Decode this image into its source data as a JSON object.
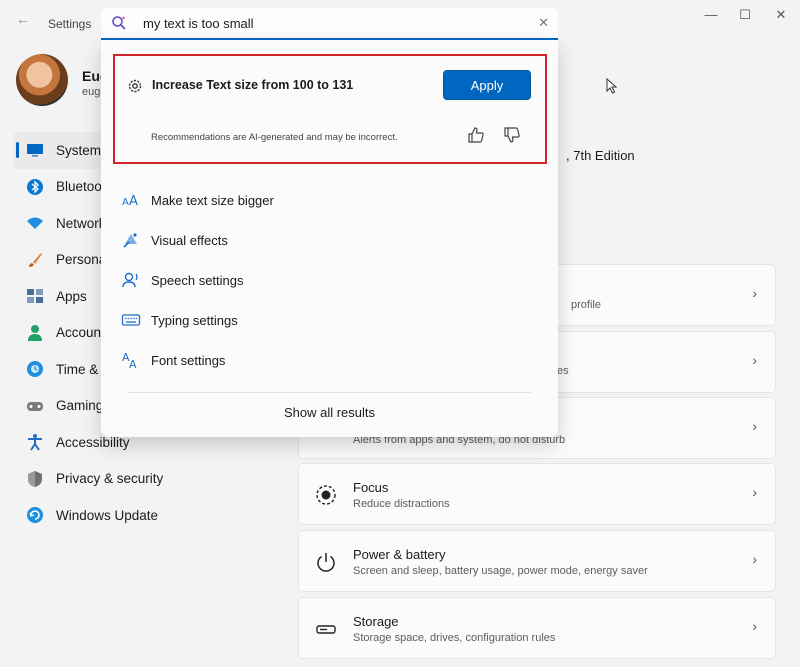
{
  "window": {
    "app_title": "Settings",
    "back_icon": "back-arrow-icon",
    "min_icon": "minimize-icon",
    "max_icon": "maximize-icon",
    "close_icon": "close-icon"
  },
  "profile": {
    "name": "Eug",
    "email": "eug"
  },
  "sidebar": {
    "items": [
      {
        "label": "System",
        "icon": "monitor-icon",
        "color": "#0067c0",
        "active": true
      },
      {
        "label": "Bluetoo",
        "icon": "bluetooth-icon",
        "color": "#0a78d4"
      },
      {
        "label": "Network",
        "icon": "wifi-icon",
        "color": "#1f8fe0"
      },
      {
        "label": "Persona",
        "icon": "brush-icon",
        "color": "#e08a3c"
      },
      {
        "label": "Apps",
        "icon": "apps-icon",
        "color": "#4a6e9a"
      },
      {
        "label": "Account",
        "icon": "person-icon",
        "color": "#1fa16a"
      },
      {
        "label": "Time &",
        "icon": "clock-globe-icon",
        "color": "#1f8fe0"
      },
      {
        "label": "Gaming",
        "icon": "gamepad-icon",
        "color": "#7b7b7b"
      },
      {
        "label": "Accessibility",
        "icon": "accessibility-icon",
        "color": "#1f6fc4"
      },
      {
        "label": "Privacy & security",
        "icon": "shield-icon",
        "color": "#707070"
      },
      {
        "label": "Windows Update",
        "icon": "update-icon",
        "color": "#1f8fe0"
      }
    ]
  },
  "main": {
    "edition": ", 7th Edition",
    "cards": [
      {
        "title": "",
        "subtitle": "profile",
        "icon": "display-icon"
      },
      {
        "title": "",
        "subtitle": "es",
        "icon": "sound-icon"
      },
      {
        "title": "",
        "subtitle": "Alerts from apps and system, do not disturb",
        "icon": "bell-icon"
      },
      {
        "title": "Focus",
        "subtitle": "Reduce distractions",
        "icon": "focus-icon"
      },
      {
        "title": "Power & battery",
        "subtitle": "Screen and sleep, battery usage, power mode, energy saver",
        "icon": "power-icon"
      },
      {
        "title": "Storage",
        "subtitle": "Storage space, drives, configuration rules",
        "icon": "storage-icon"
      }
    ]
  },
  "search": {
    "query": "my text is too small",
    "search_icon": "copilot-search-icon",
    "clear_icon": "clear-icon"
  },
  "recommendation": {
    "title": "Increase Text size from 100 to 131",
    "apply_label": "Apply",
    "note": "Recommendations are AI-generated and may be incorrect.",
    "highlight_color": "#d4252a",
    "accent": "#0067c0"
  },
  "results": [
    {
      "label": "Make text size bigger",
      "icon": "text-size-icon"
    },
    {
      "label": "Visual effects",
      "icon": "visual-effects-icon"
    },
    {
      "label": "Speech settings",
      "icon": "speech-icon"
    },
    {
      "label": "Typing settings",
      "icon": "keyboard-icon"
    },
    {
      "label": "Font settings",
      "icon": "font-icon"
    }
  ],
  "show_all_label": "Show all results"
}
